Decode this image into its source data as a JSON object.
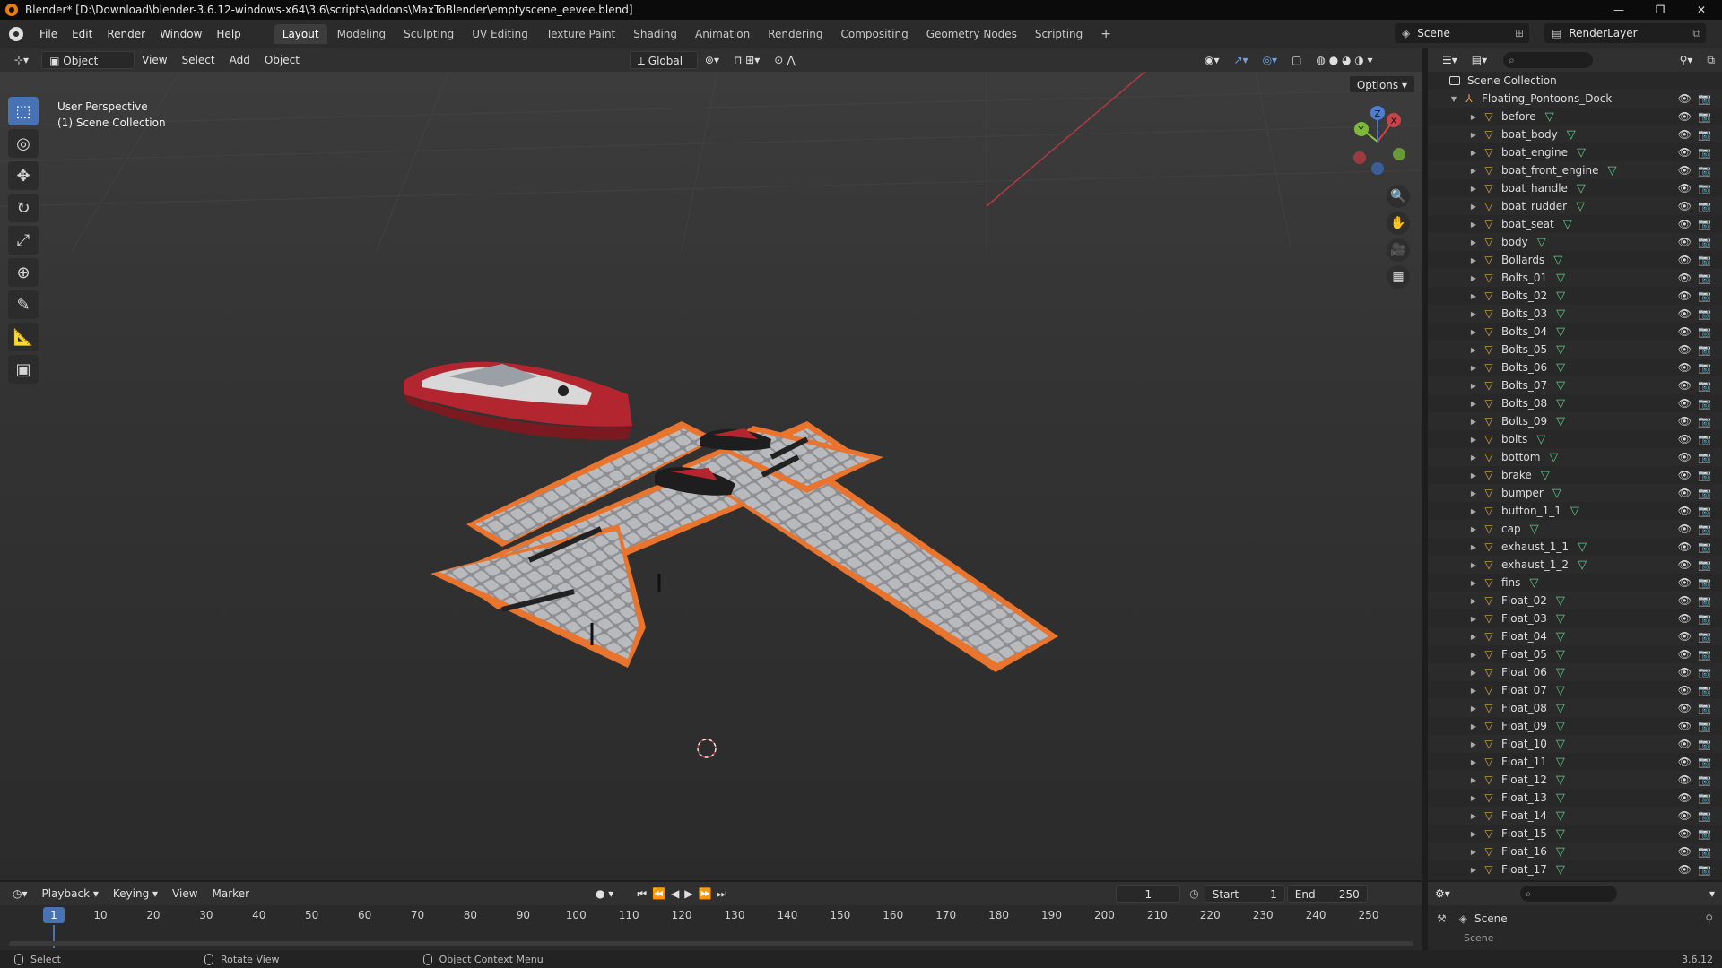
{
  "window": {
    "title": "Blender* [D:\\Download\\blender-3.6.12-windows-x64\\3.6\\scripts\\addons\\MaxToBlender\\emptyscene_eevee.blend]",
    "controls": [
      "—",
      "❐",
      "✕"
    ]
  },
  "menubar": {
    "menus": [
      "File",
      "Edit",
      "Render",
      "Window",
      "Help"
    ],
    "workspaces": [
      "Layout",
      "Modeling",
      "Sculpting",
      "UV Editing",
      "Texture Paint",
      "Shading",
      "Animation",
      "Rendering",
      "Compositing",
      "Geometry Nodes",
      "Scripting"
    ],
    "active_workspace": "Layout",
    "add_tab": "+",
    "scene": "Scene",
    "view_layer": "RenderLayer"
  },
  "viewport_header": {
    "mode": "Object Mode",
    "menus": [
      "View",
      "Select",
      "Add",
      "Object"
    ],
    "orientation": "Global",
    "options": "Options"
  },
  "viewport": {
    "perspective": "User Perspective",
    "collection": "(1) Scene Collection",
    "gizmo_axes": [
      "X",
      "Y",
      "Z"
    ]
  },
  "outliner": {
    "root": "Scene Collection",
    "collection": "Floating_Pontoons_Dock",
    "objects": [
      "before",
      "boat_body",
      "boat_engine",
      "boat_front_engine",
      "boat_handle",
      "boat_rudder",
      "boat_seat",
      "body",
      "Bollards",
      "Bolts_01",
      "Bolts_02",
      "Bolts_03",
      "Bolts_04",
      "Bolts_05",
      "Bolts_06",
      "Bolts_07",
      "Bolts_08",
      "Bolts_09",
      "bolts",
      "bottom",
      "brake",
      "bumper",
      "button_1_1",
      "cap",
      "exhaust_1_1",
      "exhaust_1_2",
      "fins",
      "Float_02",
      "Float_03",
      "Float_04",
      "Float_05",
      "Float_06",
      "Float_07",
      "Float_08",
      "Float_09",
      "Float_10",
      "Float_11",
      "Float_12",
      "Float_13",
      "Float_14",
      "Float_15",
      "Float_16",
      "Float_17"
    ]
  },
  "properties": {
    "scene_label": "Scene",
    "sub_label": "Scene"
  },
  "timeline": {
    "menus": [
      "Playback",
      "Keying",
      "View",
      "Marker"
    ],
    "current_frame": "1",
    "start_label": "Start",
    "start": "1",
    "end_label": "End",
    "end": "250",
    "ticks": [
      "1",
      "10",
      "20",
      "30",
      "40",
      "50",
      "60",
      "70",
      "80",
      "90",
      "100",
      "110",
      "120",
      "130",
      "140",
      "150",
      "160",
      "170",
      "180",
      "190",
      "200",
      "210",
      "220",
      "230",
      "240",
      "250"
    ]
  },
  "statusbar": {
    "select": "Select",
    "rotate": "Rotate View",
    "context": "Object Context Menu",
    "version": "3.6.12"
  },
  "colors": {
    "accent": "#4772b3",
    "orange": "#e87d0d",
    "mesh_green": "#62c98b",
    "boat_red": "#b3262f"
  }
}
